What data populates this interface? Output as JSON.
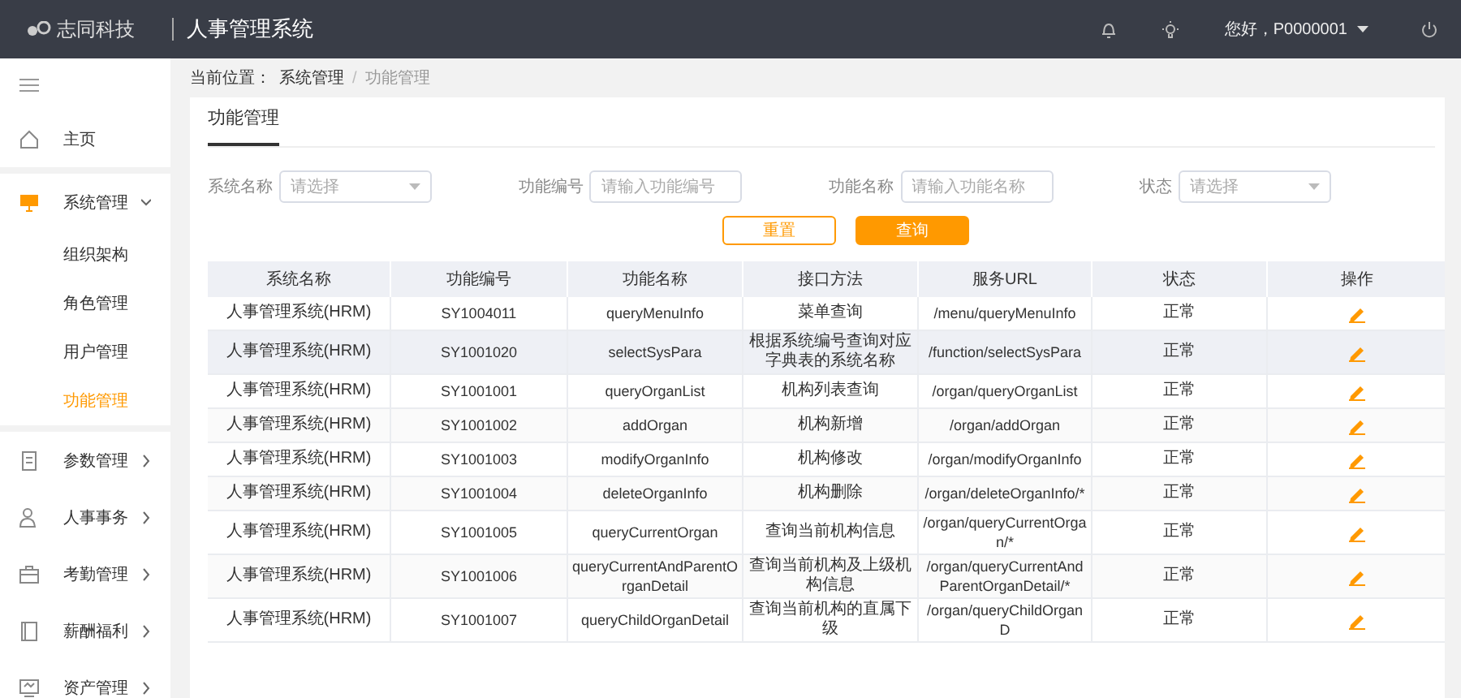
{
  "header": {
    "logo_text": "志同科技",
    "app_title": "人事管理系统",
    "greeting": "您好，P0000001"
  },
  "sidebar": {
    "items": [
      {
        "label": "主页",
        "expanded": false,
        "has_children": false,
        "selected": false
      },
      {
        "label": "系统管理",
        "expanded": true,
        "has_children": true,
        "selected": true,
        "children": [
          {
            "label": "组织架构",
            "selected": false
          },
          {
            "label": "角色管理",
            "selected": false
          },
          {
            "label": "用户管理",
            "selected": false
          },
          {
            "label": "功能管理",
            "selected": true
          }
        ]
      },
      {
        "label": "参数管理",
        "expanded": false,
        "has_children": true,
        "selected": false
      },
      {
        "label": "人事事务",
        "expanded": false,
        "has_children": true,
        "selected": false
      },
      {
        "label": "考勤管理",
        "expanded": false,
        "has_children": true,
        "selected": false
      },
      {
        "label": "薪酬福利",
        "expanded": false,
        "has_children": true,
        "selected": false
      },
      {
        "label": "资产管理",
        "expanded": false,
        "has_children": true,
        "selected": false
      }
    ]
  },
  "breadcrumb": {
    "label": "当前位置：",
    "items": [
      "系统管理",
      "功能管理"
    ],
    "separator": "/"
  },
  "page_tab": "功能管理",
  "filters": [
    {
      "label": "系统名称",
      "kind": "select",
      "placeholder": "请选择"
    },
    {
      "label": "功能编号",
      "kind": "input",
      "placeholder": "请输入功能编号"
    },
    {
      "label": "功能名称",
      "kind": "input",
      "placeholder": "请输入功能名称"
    },
    {
      "label": "状态",
      "kind": "select",
      "placeholder": "请选择"
    }
  ],
  "buttons": [
    {
      "label": "重置",
      "kind": "outline"
    },
    {
      "label": "查询",
      "kind": "primary"
    }
  ],
  "table": {
    "columns": [
      "系统名称",
      "功能编号",
      "功能名称",
      "接口方法",
      "服务URL",
      "状态",
      "操作"
    ],
    "rows": [
      {
        "highlighted": false,
        "cells": [
          "人事管理系统(HRM)",
          "SY1004011",
          "queryMenuInfo",
          "菜单查询",
          "/menu/queryMenuInfo",
          "正常"
        ]
      },
      {
        "highlighted": true,
        "cells": [
          "人事管理系统(HRM)",
          "SY1001020",
          "selectSysPara",
          "根据系统编号查询对应字典表的系统名称",
          "/function/selectSysPara",
          "正常"
        ]
      },
      {
        "highlighted": false,
        "cells": [
          "人事管理系统(HRM)",
          "SY1001001",
          "queryOrganList",
          "机构列表查询",
          "/organ/queryOrganList",
          "正常"
        ]
      },
      {
        "highlighted": false,
        "cells": [
          "人事管理系统(HRM)",
          "SY1001002",
          "addOrgan",
          "机构新增",
          "/organ/addOrgan",
          "正常"
        ]
      },
      {
        "highlighted": false,
        "cells": [
          "人事管理系统(HRM)",
          "SY1001003",
          "modifyOrganInfo",
          "机构修改",
          "/organ/modifyOrganInfo",
          "正常"
        ]
      },
      {
        "highlighted": false,
        "cells": [
          "人事管理系统(HRM)",
          "SY1001004",
          "deleteOrganInfo",
          "机构删除",
          "/organ/deleteOrganInfo/*",
          "正常"
        ]
      },
      {
        "highlighted": false,
        "cells": [
          "人事管理系统(HRM)",
          "SY1001005",
          "queryCurrentOrgan",
          "查询当前机构信息",
          "/organ/queryCurrentOrgan/*",
          "正常"
        ]
      },
      {
        "highlighted": false,
        "cells": [
          "人事管理系统(HRM)",
          "SY1001006",
          "queryCurrentAndParentOrganDetail",
          "查询当前机构及上级机构信息",
          "/organ/queryCurrentAndParentOrganDetail/*",
          "正常"
        ]
      },
      {
        "highlighted": false,
        "cells": [
          "人事管理系统(HRM)",
          "SY1001007",
          "queryChildOrganDetail",
          "查询当前机构的直属下级",
          "/organ/queryChildOrganD",
          "正常"
        ]
      }
    ]
  }
}
